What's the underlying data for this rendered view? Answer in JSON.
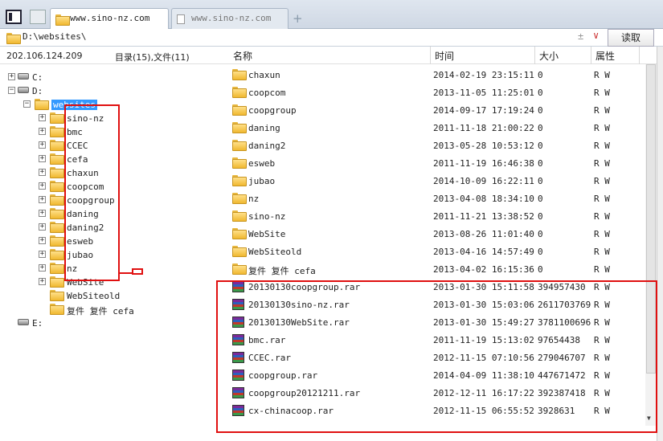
{
  "tabs": [
    {
      "label": "www.sino-nz.com",
      "active": true
    },
    {
      "label": "www.sino-nz.com",
      "active": false
    }
  ],
  "address": {
    "path": "D:\\websites\\",
    "controls": "±",
    "read_label": "读取"
  },
  "status": {
    "ip": "202.106.124.209",
    "counts": "目录(15),文件(11)"
  },
  "columns": {
    "name": "名称",
    "time": "时间",
    "size": "大小",
    "attr": "属性"
  },
  "tree": {
    "drives": [
      "C:",
      "D:",
      "E:"
    ],
    "selected": "websites",
    "children": [
      "sino-nz",
      "bmc",
      "CCEC",
      "cefa",
      "chaxun",
      "coopcom",
      "coopgroup",
      "daning",
      "daning2",
      "esweb",
      "jubao",
      "nz",
      "WebSite",
      "WebSiteold",
      "复件 复件 cefa"
    ]
  },
  "files": [
    {
      "name": "chaxun",
      "time": "2014-02-19 23:15:11",
      "size": "0",
      "attr": "R W",
      "type": "folder"
    },
    {
      "name": "coopcom",
      "time": "2013-11-05 11:25:01",
      "size": "0",
      "attr": "R W",
      "type": "folder"
    },
    {
      "name": "coopgroup",
      "time": "2014-09-17 17:19:24",
      "size": "0",
      "attr": "R W",
      "type": "folder"
    },
    {
      "name": "daning",
      "time": "2011-11-18 21:00:22",
      "size": "0",
      "attr": "R W",
      "type": "folder"
    },
    {
      "name": "daning2",
      "time": "2013-05-28 10:53:12",
      "size": "0",
      "attr": "R W",
      "type": "folder"
    },
    {
      "name": "esweb",
      "time": "2011-11-19 16:46:38",
      "size": "0",
      "attr": "R W",
      "type": "folder"
    },
    {
      "name": "jubao",
      "time": "2014-10-09 16:22:11",
      "size": "0",
      "attr": "R W",
      "type": "folder"
    },
    {
      "name": "nz",
      "time": "2013-04-08 18:34:10",
      "size": "0",
      "attr": "R W",
      "type": "folder"
    },
    {
      "name": "sino-nz",
      "time": "2011-11-21 13:38:52",
      "size": "0",
      "attr": "R W",
      "type": "folder"
    },
    {
      "name": "WebSite",
      "time": "2013-08-26 11:01:40",
      "size": "0",
      "attr": "R W",
      "type": "folder"
    },
    {
      "name": "WebSiteold",
      "time": "2013-04-16 14:57:49",
      "size": "0",
      "attr": "R W",
      "type": "folder"
    },
    {
      "name": "复件 复件 cefa",
      "time": "2013-04-02 16:15:36",
      "size": "0",
      "attr": "R W",
      "type": "folder"
    },
    {
      "name": "20130130coopgroup.rar",
      "time": "2013-01-30 15:11:58",
      "size": "394957430",
      "attr": "R W",
      "type": "rar"
    },
    {
      "name": "20130130sino-nz.rar",
      "time": "2013-01-30 15:03:06",
      "size": "2611703769",
      "attr": "R W",
      "type": "rar"
    },
    {
      "name": "20130130WebSite.rar",
      "time": "2013-01-30 15:49:27",
      "size": "3781100696",
      "attr": "R W",
      "type": "rar"
    },
    {
      "name": "bmc.rar",
      "time": "2011-11-19 15:13:02",
      "size": "97654438",
      "attr": "R W",
      "type": "rar"
    },
    {
      "name": "CCEC.rar",
      "time": "2012-11-15 07:10:56",
      "size": "279046707",
      "attr": "R W",
      "type": "rar"
    },
    {
      "name": "coopgroup.rar",
      "time": "2014-04-09 11:38:10",
      "size": "447671472",
      "attr": "R W",
      "type": "rar"
    },
    {
      "name": "coopgroup20121211.rar",
      "time": "2012-12-11 16:17:22",
      "size": "392387418",
      "attr": "R W",
      "type": "rar"
    },
    {
      "name": "cx-chinacoop.rar",
      "time": "2012-11-15 06:55:52",
      "size": "3928631",
      "attr": "R W",
      "type": "rar"
    }
  ]
}
